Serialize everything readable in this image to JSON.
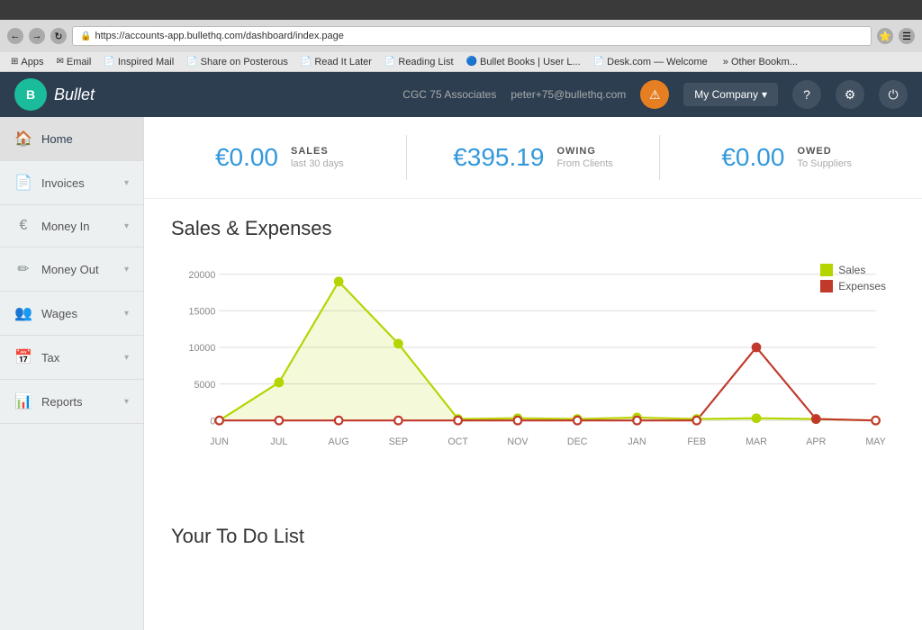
{
  "browser": {
    "url": "https://accounts-app.bullethq.com/dashboard/index.page",
    "nav_back": "←",
    "nav_forward": "→",
    "nav_refresh": "↻",
    "bookmarks": [
      {
        "label": "Apps",
        "icon": "⊞"
      },
      {
        "label": "Email",
        "icon": "✉",
        "favicon": "G"
      },
      {
        "label": "Inspired Mail",
        "icon": "📄"
      },
      {
        "label": "Share on Posterous",
        "icon": "📄"
      },
      {
        "label": "Read It Later",
        "icon": "📄"
      },
      {
        "label": "Reading List",
        "icon": "📄"
      },
      {
        "label": "Bullet Books | User L...",
        "icon": "🔵"
      },
      {
        "label": "Desk.com — Welcome",
        "icon": "📄"
      },
      {
        "label": "» Other Bookm...",
        "icon": ""
      }
    ]
  },
  "topnav": {
    "logo_text": "Bullet",
    "logo_initial": "B",
    "company": "CGC 75 Associates",
    "user_email": "peter+75@bullethq.com",
    "company_btn_label": "My Company",
    "warning_label": "⚠",
    "help_label": "?",
    "settings_label": "⚙",
    "power_label": "⏻"
  },
  "sidebar": {
    "items": [
      {
        "id": "home",
        "label": "Home",
        "icon": "🏠",
        "active": true,
        "chevron": false
      },
      {
        "id": "invoices",
        "label": "Invoices",
        "icon": "📄",
        "active": false,
        "chevron": true
      },
      {
        "id": "money-in",
        "label": "Money In",
        "icon": "€",
        "active": false,
        "chevron": true
      },
      {
        "id": "money-out",
        "label": "Money Out",
        "icon": "✏",
        "active": false,
        "chevron": true
      },
      {
        "id": "wages",
        "label": "Wages",
        "icon": "👥",
        "active": false,
        "chevron": true
      },
      {
        "id": "tax",
        "label": "Tax",
        "icon": "📅",
        "active": false,
        "chevron": true
      },
      {
        "id": "reports",
        "label": "Reports",
        "icon": "📊",
        "active": false,
        "chevron": true
      }
    ]
  },
  "stats": [
    {
      "amount": "€0.00",
      "label": "SALES",
      "sublabel": "last 30 days"
    },
    {
      "amount": "€395.19",
      "label": "OWING",
      "sublabel": "From Clients"
    },
    {
      "amount": "€0.00",
      "label": "OWED",
      "sublabel": "To Suppliers"
    }
  ],
  "chart": {
    "title": "Sales & Expenses",
    "legend": [
      {
        "label": "Sales",
        "color": "#b5d400"
      },
      {
        "label": "Expenses",
        "color": "#c0392b"
      }
    ],
    "x_labels": [
      "JUN",
      "JUL",
      "AUG",
      "SEP",
      "OCT",
      "NOV",
      "DEC",
      "JAN",
      "FEB",
      "MAR",
      "APR",
      "MAY"
    ],
    "sales_data": [
      0,
      5200,
      19000,
      10500,
      200,
      300,
      200,
      400,
      200,
      300,
      200,
      0
    ],
    "expenses_data": [
      0,
      0,
      0,
      0,
      0,
      0,
      0,
      0,
      0,
      10000,
      200,
      0
    ],
    "y_max": 20000,
    "y_labels": [
      "20000",
      "15000",
      "10000",
      "5000",
      "0"
    ]
  },
  "todo": {
    "title": "Your To Do List"
  }
}
